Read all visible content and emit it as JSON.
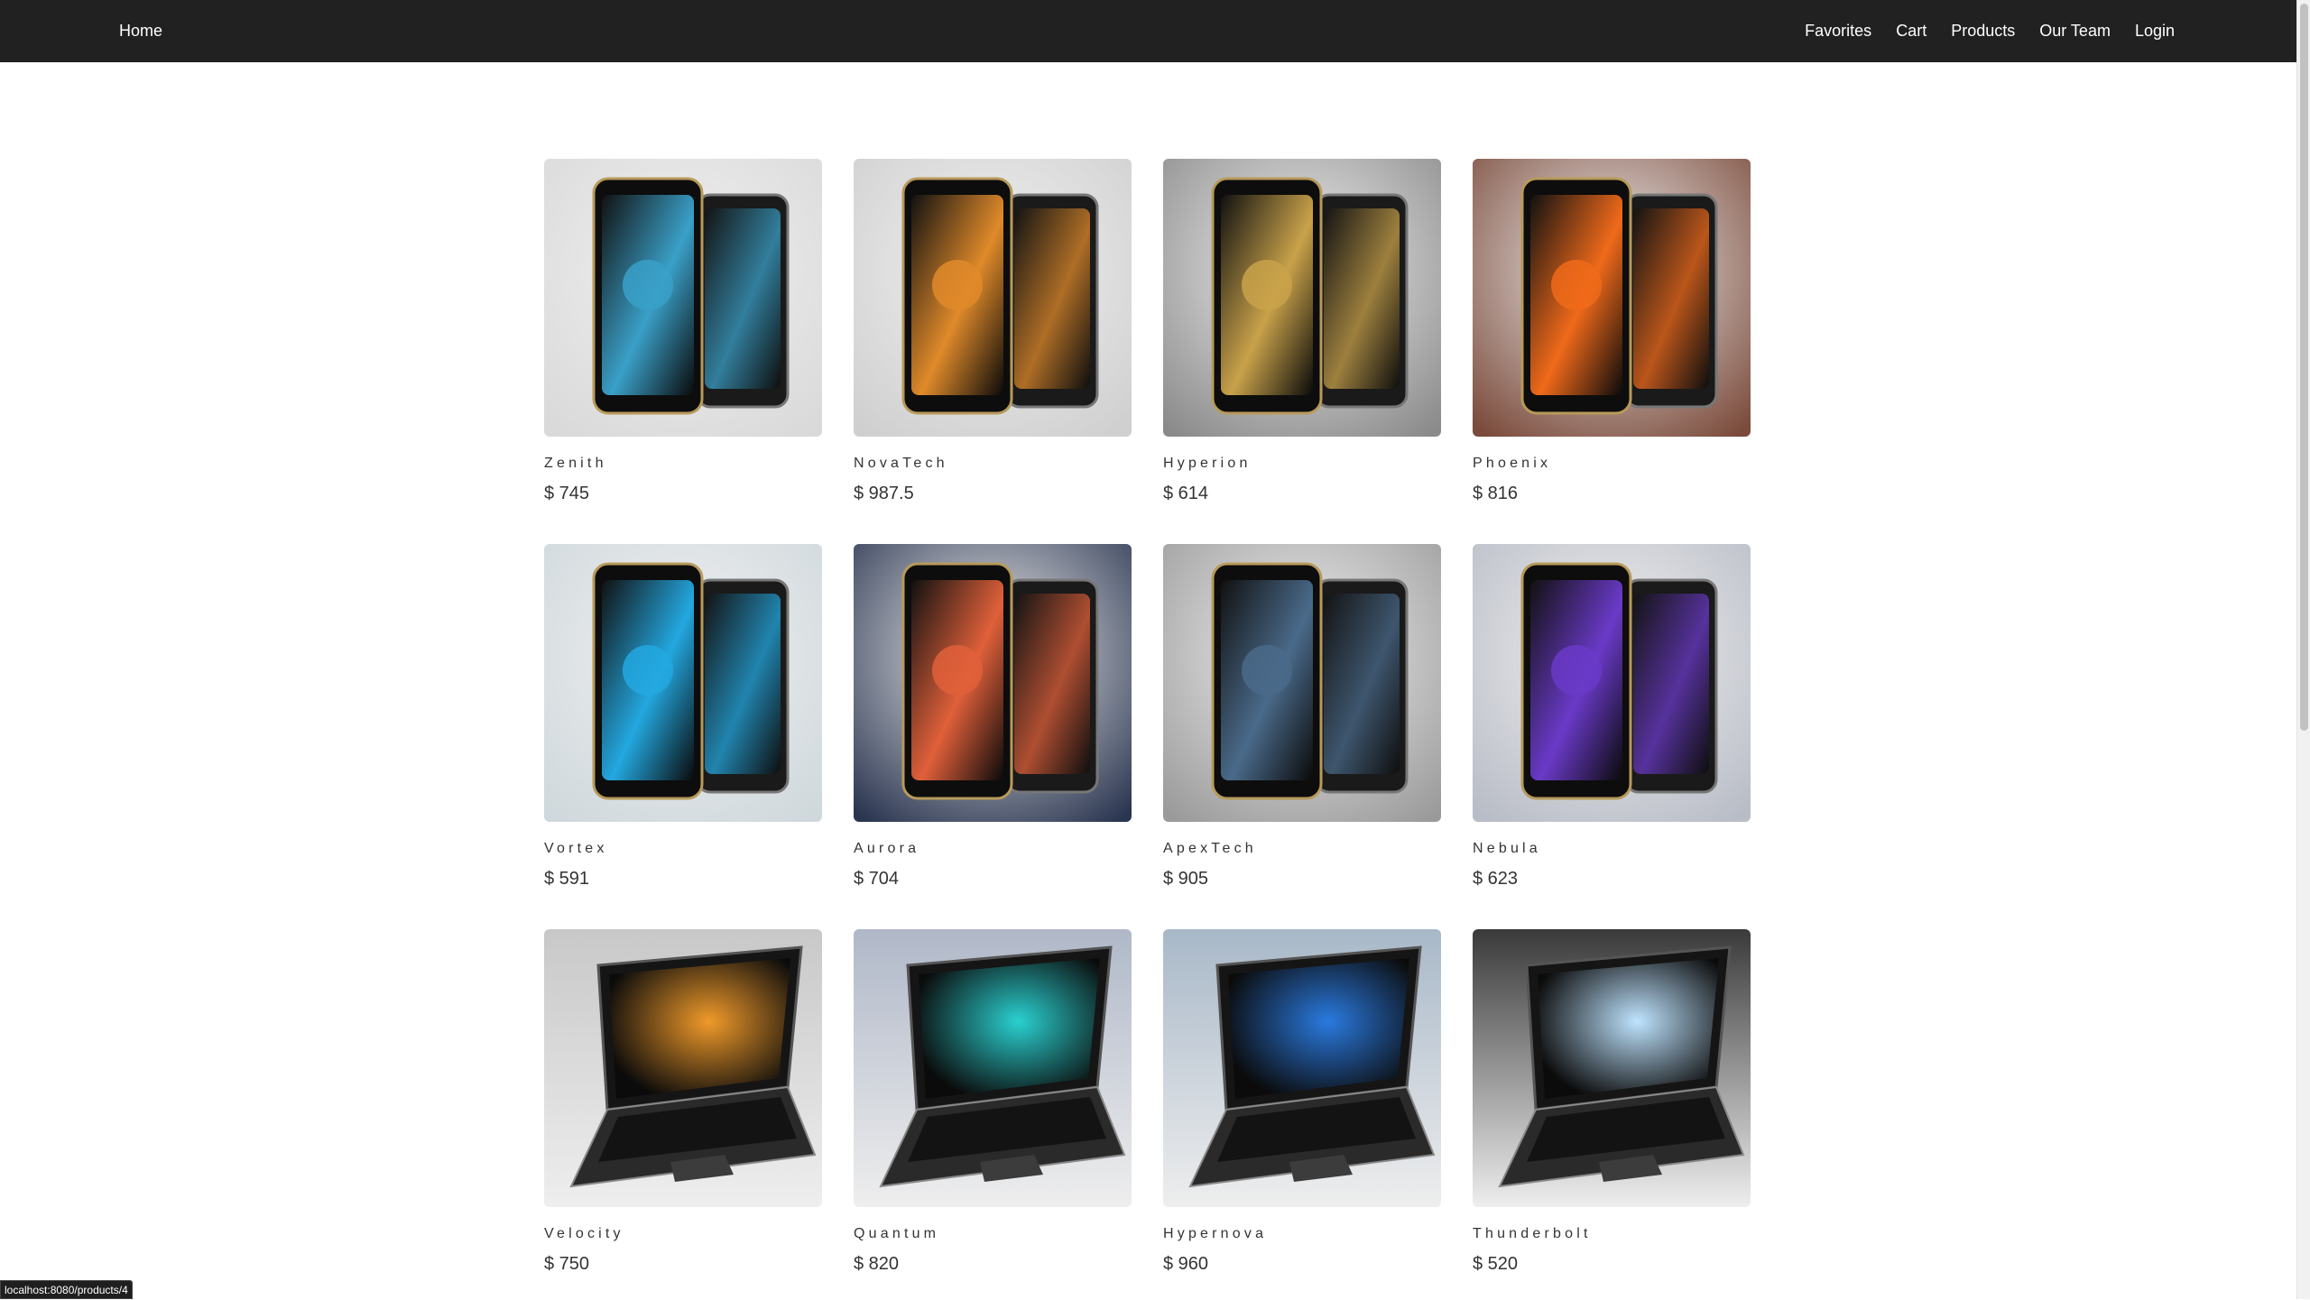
{
  "nav": {
    "home": "Home",
    "favorites": "Favorites",
    "cart": "Cart",
    "products": "Products",
    "our_team": "Our Team",
    "login": "Login"
  },
  "products": [
    {
      "name": "Zenith",
      "price": "$ 745",
      "kind": "phone",
      "bg": "#d9d9d9",
      "accent": "#3aa0c8"
    },
    {
      "name": "NovaTech",
      "price": "$ 987.5",
      "kind": "phone",
      "bg": "#cfcfcf",
      "accent": "#e08a2a"
    },
    {
      "name": "Hyperion",
      "price": "$ 614",
      "kind": "phone",
      "bg": "#8a8a8a",
      "accent": "#c9a24a"
    },
    {
      "name": "Phoenix",
      "price": "$ 816",
      "kind": "phone",
      "bg": "#7a4a3a",
      "accent": "#f06a1a"
    },
    {
      "name": "Vortex",
      "price": "$ 591",
      "kind": "phone",
      "bg": "#cfd8dc",
      "accent": "#23a8e0"
    },
    {
      "name": "Aurora",
      "price": "$ 704",
      "kind": "phone",
      "bg": "#2a3550",
      "accent": "#e0603a"
    },
    {
      "name": "ApexTech",
      "price": "$ 905",
      "kind": "phone",
      "bg": "#9a9a9a",
      "accent": "#4a6a8a"
    },
    {
      "name": "Nebula",
      "price": "$ 623",
      "kind": "phone",
      "bg": "#b8bcc6",
      "accent": "#6a3ac8"
    },
    {
      "name": "Velocity",
      "price": "$ 750",
      "kind": "laptop",
      "bg": "#c8c8c8",
      "accent": "#f09a2a"
    },
    {
      "name": "Quantum",
      "price": "$ 820",
      "kind": "laptop",
      "bg": "#b0b8c8",
      "accent": "#2ad0d0"
    },
    {
      "name": "Hypernova",
      "price": "$ 960",
      "kind": "laptop",
      "bg": "#a8b8c8",
      "accent": "#2a7ae0"
    },
    {
      "name": "Thunderbolt",
      "price": "$ 520",
      "kind": "laptop",
      "bg": "#3a3a3a",
      "accent": "#bfe4ff"
    }
  ],
  "status_url": "localhost:8080/products/4"
}
